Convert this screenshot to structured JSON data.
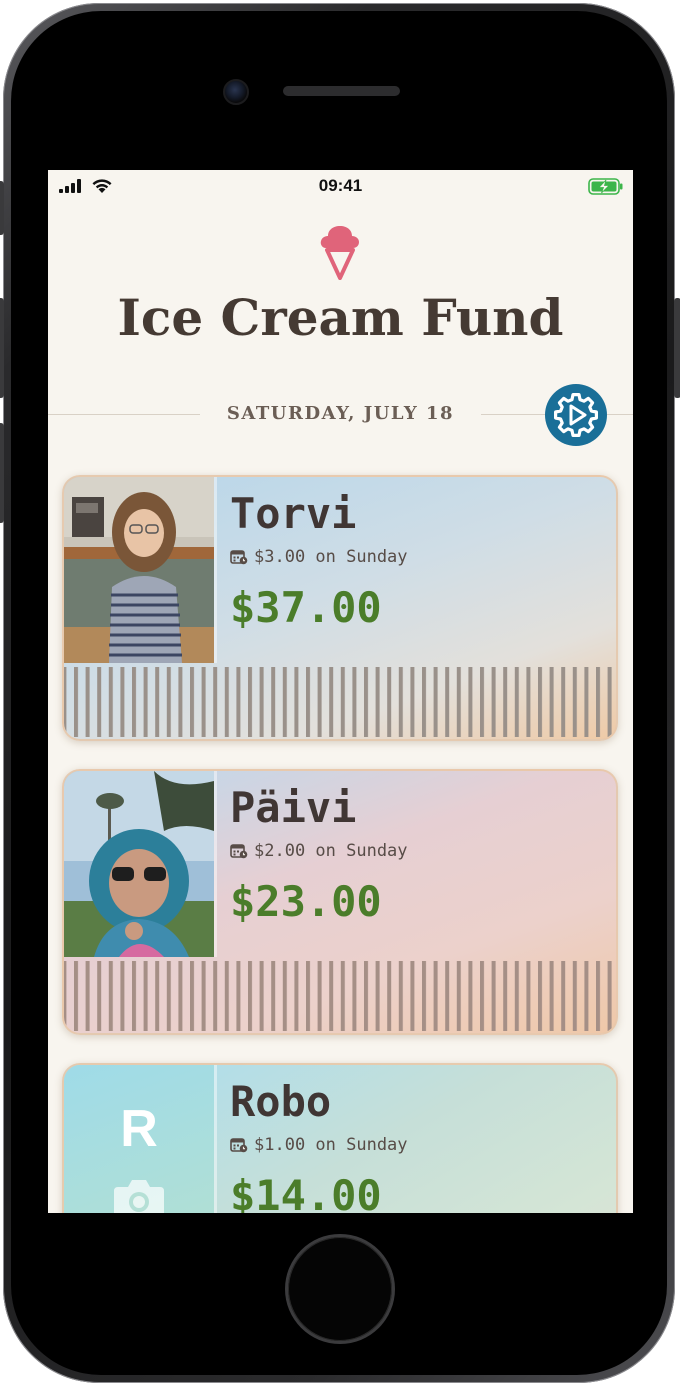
{
  "status_bar": {
    "time": "09:41"
  },
  "app": {
    "title": "Ice Cream Fund",
    "date": "SATURDAY, JULY 18",
    "icon": "ice-cream-cone-icon",
    "settings_icon": "gear-play-icon"
  },
  "colors": {
    "background": "#f8f5ef",
    "title": "#453a33",
    "amount": "#4b7d2a",
    "accent": "#1a6f98",
    "icon": "#e0647a"
  },
  "kids": [
    {
      "name": "Torvi",
      "allowance": "$3.00 on Sunday",
      "balance": "$37.00",
      "photo": "photo"
    },
    {
      "name": "Päivi",
      "allowance": "$2.00 on Sunday",
      "balance": "$23.00",
      "photo": "photo"
    },
    {
      "name": "Robo",
      "allowance": "$1.00 on Sunday",
      "balance": "$14.00",
      "photo": "placeholder",
      "initial": "R",
      "photo_icon": "camera-icon"
    }
  ]
}
